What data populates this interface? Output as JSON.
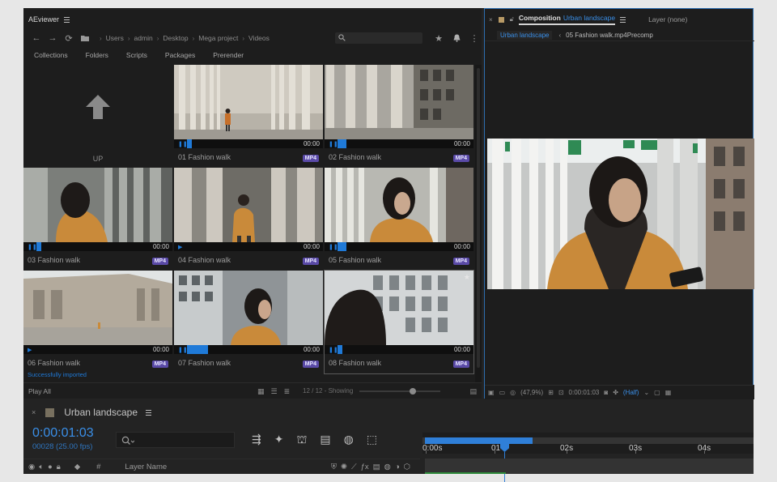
{
  "aeviewer": {
    "title": "AEviewer",
    "breadcrumbs": [
      "Users",
      "admin",
      "Desktop",
      "Mega project",
      "Videos"
    ],
    "tabs": [
      "Collections",
      "Folders",
      "Scripts",
      "Packages",
      "Prerender"
    ],
    "up_label": "UP",
    "items": [
      {
        "label": "01 Fashion walk",
        "time": "00:00",
        "badge": "MP4",
        "progress": 0.03
      },
      {
        "label": "02 Fashion walk",
        "time": "00:00",
        "badge": "MP4",
        "progress": 0.06
      },
      {
        "label": "03 Fashion walk",
        "time": "00:00",
        "badge": "MP4",
        "progress": 0.03
      },
      {
        "label": "04 Fashion walk",
        "time": "00:00",
        "badge": "MP4",
        "progress": 0.0
      },
      {
        "label": "05 Fashion walk",
        "time": "00:00",
        "badge": "MP4",
        "progress": 0.06
      },
      {
        "label": "06 Fashion walk",
        "time": "00:00",
        "badge": "MP4",
        "progress": 0.0,
        "status": "Successfully imported"
      },
      {
        "label": "07 Fashion walk",
        "time": "00:00",
        "badge": "MP4",
        "progress": 0.14
      },
      {
        "label": "08 Fashion walk",
        "time": "00:00",
        "badge": "MP4",
        "progress": 0.03
      }
    ],
    "footer": {
      "play_all": "Play All",
      "count": "12 / 12 - Showing"
    }
  },
  "composition": {
    "label": "Composition",
    "name": "Urban landscape",
    "layer": "Layer (none)",
    "crumbs": [
      "Urban landscape",
      "05 Fashion walk.mp4Precomp"
    ],
    "zoom": "(47,9%)",
    "time": "0:00:01:03",
    "resolution": "(Half)"
  },
  "timeline": {
    "title": "Urban landscape",
    "timecode": "0:00:01:03",
    "frames": "00028 (25.00 fps)",
    "ruler": [
      "0:00s",
      "01",
      "02s",
      "03s",
      "04s"
    ],
    "layer_name_header": "Layer Name",
    "hash": "#"
  },
  "colors": {
    "accent": "#1f7ad8",
    "badge": "#5a4aa7",
    "panel_bg": "#1d1d1d"
  }
}
